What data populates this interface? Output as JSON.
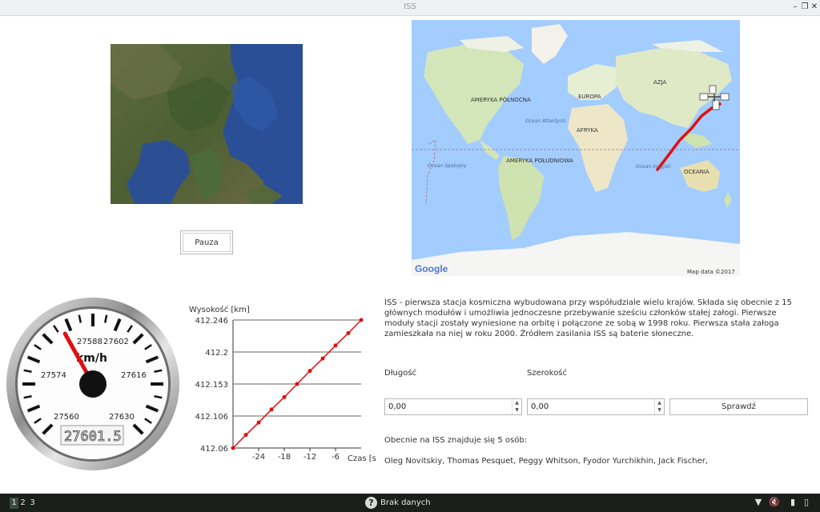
{
  "window": {
    "title": "ISS"
  },
  "controls": {
    "pause_label": "Pauza"
  },
  "map": {
    "attribution": "Map data ©2017",
    "logo": "Google",
    "continents": [
      "AMERYKA PÓŁNOCNA",
      "EUROPA",
      "AZJA",
      "AFRYKA",
      "AMERYKA POŁUDNIOWA",
      "OCEANIA"
    ],
    "oceans": [
      "Ocean Atlantycki",
      "Ocean Spokojny",
      "Ocean Indyjski"
    ]
  },
  "gauge": {
    "unit": "km/h",
    "ticks": [
      "27588",
      "27602",
      "27574",
      "27616",
      "27560",
      "27630"
    ],
    "readout": "27601.5",
    "value": 27586,
    "min": 27553,
    "max": 27637
  },
  "chart_data": {
    "type": "line",
    "ylabel": "Wysokość [km]",
    "xlabel": "Czas [s]",
    "y_ticks": [
      "412.246",
      "412.2",
      "412.153",
      "412.106",
      "412.06"
    ],
    "x_ticks": [
      "-24",
      "-18",
      "-12",
      "-6"
    ],
    "ylim": [
      412.06,
      412.246
    ],
    "xlim": [
      -30,
      0
    ],
    "grid": true,
    "series": [
      {
        "x": [
          -30,
          -27,
          -24,
          -21,
          -18,
          -15,
          -12,
          -9,
          -6,
          -3,
          0
        ],
        "y": [
          412.06,
          412.079,
          412.097,
          412.116,
          412.134,
          412.153,
          412.172,
          412.19,
          412.209,
          412.227,
          412.246
        ]
      }
    ]
  },
  "description": "ISS - pierwsza stacja kosmiczna wybudowana przy współudziale wielu krajów. Składa się obecnie z 15 głównych modułów i umożliwia jednoczesne przebywanie sześciu członków stałej załogi. Pierwsze moduły stacji zostały wyniesione na orbitę i połączone ze sobą w 1998 roku. Pierwsza stała załoga zamieszkała na niej w roku 2000. Źródłem zasilania ISS są baterie słoneczne.",
  "coords": {
    "longitude_label": "Długość",
    "latitude_label": "Szerokość",
    "longitude_value": "0,00",
    "latitude_value": "0,00",
    "check_label": "Sprawdź"
  },
  "crew": {
    "count_text": "Obecnie na ISS znajduje się 5 osób:",
    "names": "Oleg Novitskiy, Thomas Pesquet, Peggy Whitson, Fyodor Yurchikhin, Jack Fischer,"
  },
  "taskbar": {
    "workspaces": [
      "1",
      "2",
      "3"
    ],
    "status": "Brak danych",
    "help_icon": "?"
  }
}
